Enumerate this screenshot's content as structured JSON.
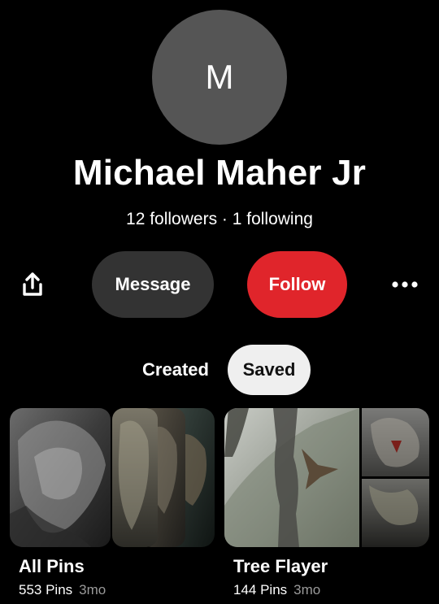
{
  "profile": {
    "avatar_initial": "M",
    "name": "Michael Maher Jr",
    "stats": "12 followers · 1 following"
  },
  "actions": {
    "share_icon": "share-icon",
    "message_label": "Message",
    "follow_label": "Follow",
    "more_icon": "more-icon"
  },
  "tabs": [
    {
      "label": "Created",
      "selected": false
    },
    {
      "label": "Saved",
      "selected": true
    }
  ],
  "boards": [
    {
      "title": "All Pins",
      "count": "553 Pins",
      "age": "3mo"
    },
    {
      "title": "Tree Flayer",
      "count": "144 Pins",
      "age": "3mo"
    }
  ],
  "colors": {
    "background": "#000000",
    "avatar": "#555555",
    "message_button": "#333333",
    "follow_button": "#e0252b",
    "selected_tab": "#efefef"
  }
}
